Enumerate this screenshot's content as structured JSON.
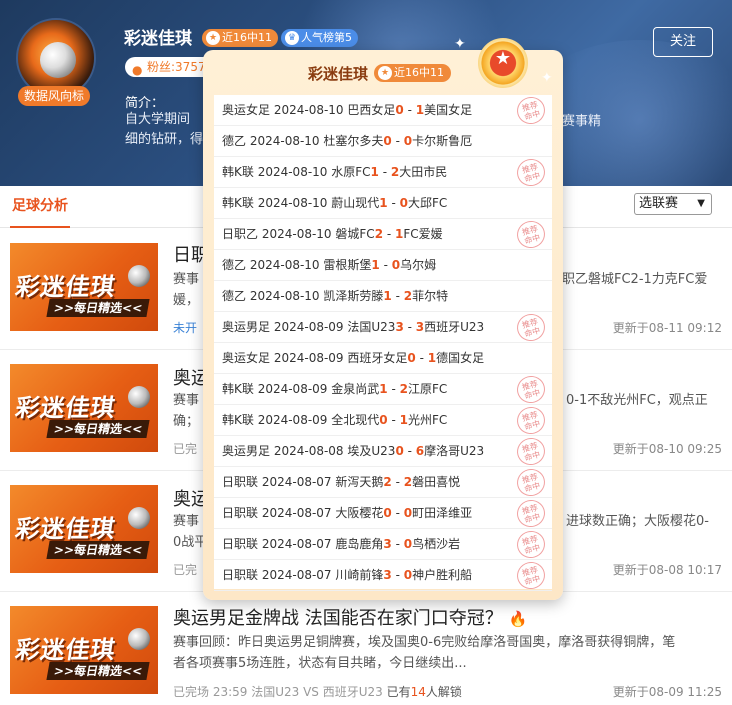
{
  "profile": {
    "name": "彩迷佳琪",
    "avatar_tag": "数据风向标",
    "badge_record": "近16中11",
    "badge_rank": "人气榜第5",
    "fans": "粉丝:3757",
    "intro_label": "简介：",
    "intro_line1": "自大学期间",
    "intro_line2": "细的钻研，得",
    "intro_tail": "赛事精",
    "follow_label": "关注"
  },
  "tabs": {
    "active": "足球分析"
  },
  "league_select": {
    "value": "选联赛"
  },
  "thumb": {
    "title": "彩迷佳琪",
    "subtitle": ">>每日精选<<"
  },
  "articles": [
    {
      "title": "日职",
      "desc1": "赛事",
      "desc1_tail": "职乙磐城FC2-1力克FC爱",
      "desc2": "媛，",
      "meta": "未开",
      "time": "更新于08-11 09:12"
    },
    {
      "title": "奥运",
      "desc1": "赛事",
      "desc1_tail": "0-1不敌光州FC，观点正",
      "desc2": "确；",
      "meta": "已完",
      "time": "更新于08-10 09:25"
    },
    {
      "title": "奥运",
      "desc1": "赛事",
      "desc1_tail": "进球数正确；大阪樱花0-",
      "desc2": "0战平",
      "meta": "已完",
      "time": "更新于08-08 10:17"
    },
    {
      "title": "奥运男足金牌战 法国能否在家门口夺冠？",
      "desc1": "赛事回顾：昨日奥运男足铜牌赛，埃及国奥0-6完败给摩洛哥国奥，摩洛哥获得铜牌，笔",
      "desc1_tail": "",
      "desc2": "者各项赛事5场连胜，状态有目共睹，今日继续出...",
      "meta_prefix": "已完场 23:59 法国U23 VS 西班牙U23",
      "meta_unlock_pre": "已有",
      "meta_unlock_count": "14",
      "meta_unlock_post": "人解锁",
      "time": "更新于08-09 11:25"
    }
  ],
  "popup": {
    "name": "彩迷佳琪",
    "badge": "近16中11",
    "stamp_text": "推荐命中",
    "rows": [
      {
        "league": "奥运女足",
        "date": "2024-08-10",
        "home": "巴西女足",
        "hs": "0",
        "as": "1",
        "away": "美国女足",
        "hit": true
      },
      {
        "league": "德乙",
        "date": "2024-08-10",
        "home": "杜塞尔多夫",
        "hs": "0",
        "as": "0",
        "away": "卡尔斯鲁厄",
        "hit": false
      },
      {
        "league": "韩K联",
        "date": "2024-08-10",
        "home": "水原FC",
        "hs": "1",
        "as": "2",
        "away": "大田市民",
        "hit": true
      },
      {
        "league": "韩K联",
        "date": "2024-08-10",
        "home": "蔚山现代",
        "hs": "1",
        "as": "0",
        "away": "大邱FC",
        "hit": false
      },
      {
        "league": "日职乙",
        "date": "2024-08-10",
        "home": "磐城FC",
        "hs": "2",
        "as": "1",
        "away": "FC爱媛",
        "hit": true
      },
      {
        "league": "德乙",
        "date": "2024-08-10",
        "home": "雷根斯堡",
        "hs": "1",
        "as": "0",
        "away": "乌尔姆",
        "hit": false
      },
      {
        "league": "德乙",
        "date": "2024-08-10",
        "home": "凯泽斯劳滕",
        "hs": "1",
        "as": "2",
        "away": "菲尔特",
        "hit": false
      },
      {
        "league": "奥运男足",
        "date": "2024-08-09",
        "home": "法国U23",
        "hs": "3",
        "as": "3",
        "away": "西班牙U23",
        "hit": true
      },
      {
        "league": "奥运女足",
        "date": "2024-08-09",
        "home": "西班牙女足",
        "hs": "0",
        "as": "1",
        "away": "德国女足",
        "hit": false
      },
      {
        "league": "韩K联",
        "date": "2024-08-09",
        "home": "金泉尚武",
        "hs": "1",
        "as": "2",
        "away": "江原FC",
        "hit": true
      },
      {
        "league": "韩K联",
        "date": "2024-08-09",
        "home": "全北现代",
        "hs": "0",
        "as": "1",
        "away": "光州FC",
        "hit": true
      },
      {
        "league": "奥运男足",
        "date": "2024-08-08",
        "home": "埃及U23",
        "hs": "0",
        "as": "6",
        "away": "摩洛哥U23",
        "hit": true
      },
      {
        "league": "日职联",
        "date": "2024-08-07",
        "home": "新泻天鹅",
        "hs": "2",
        "as": "2",
        "away": "磐田喜悦",
        "hit": true
      },
      {
        "league": "日职联",
        "date": "2024-08-07",
        "home": "大阪樱花",
        "hs": "0",
        "as": "0",
        "away": "町田泽维亚",
        "hit": true
      },
      {
        "league": "日职联",
        "date": "2024-08-07",
        "home": "鹿岛鹿角",
        "hs": "3",
        "as": "0",
        "away": "鸟栖沙岩",
        "hit": true
      },
      {
        "league": "日职联",
        "date": "2024-08-07",
        "home": "川崎前锋",
        "hs": "3",
        "as": "0",
        "away": "神户胜利船",
        "hit": true
      }
    ]
  }
}
